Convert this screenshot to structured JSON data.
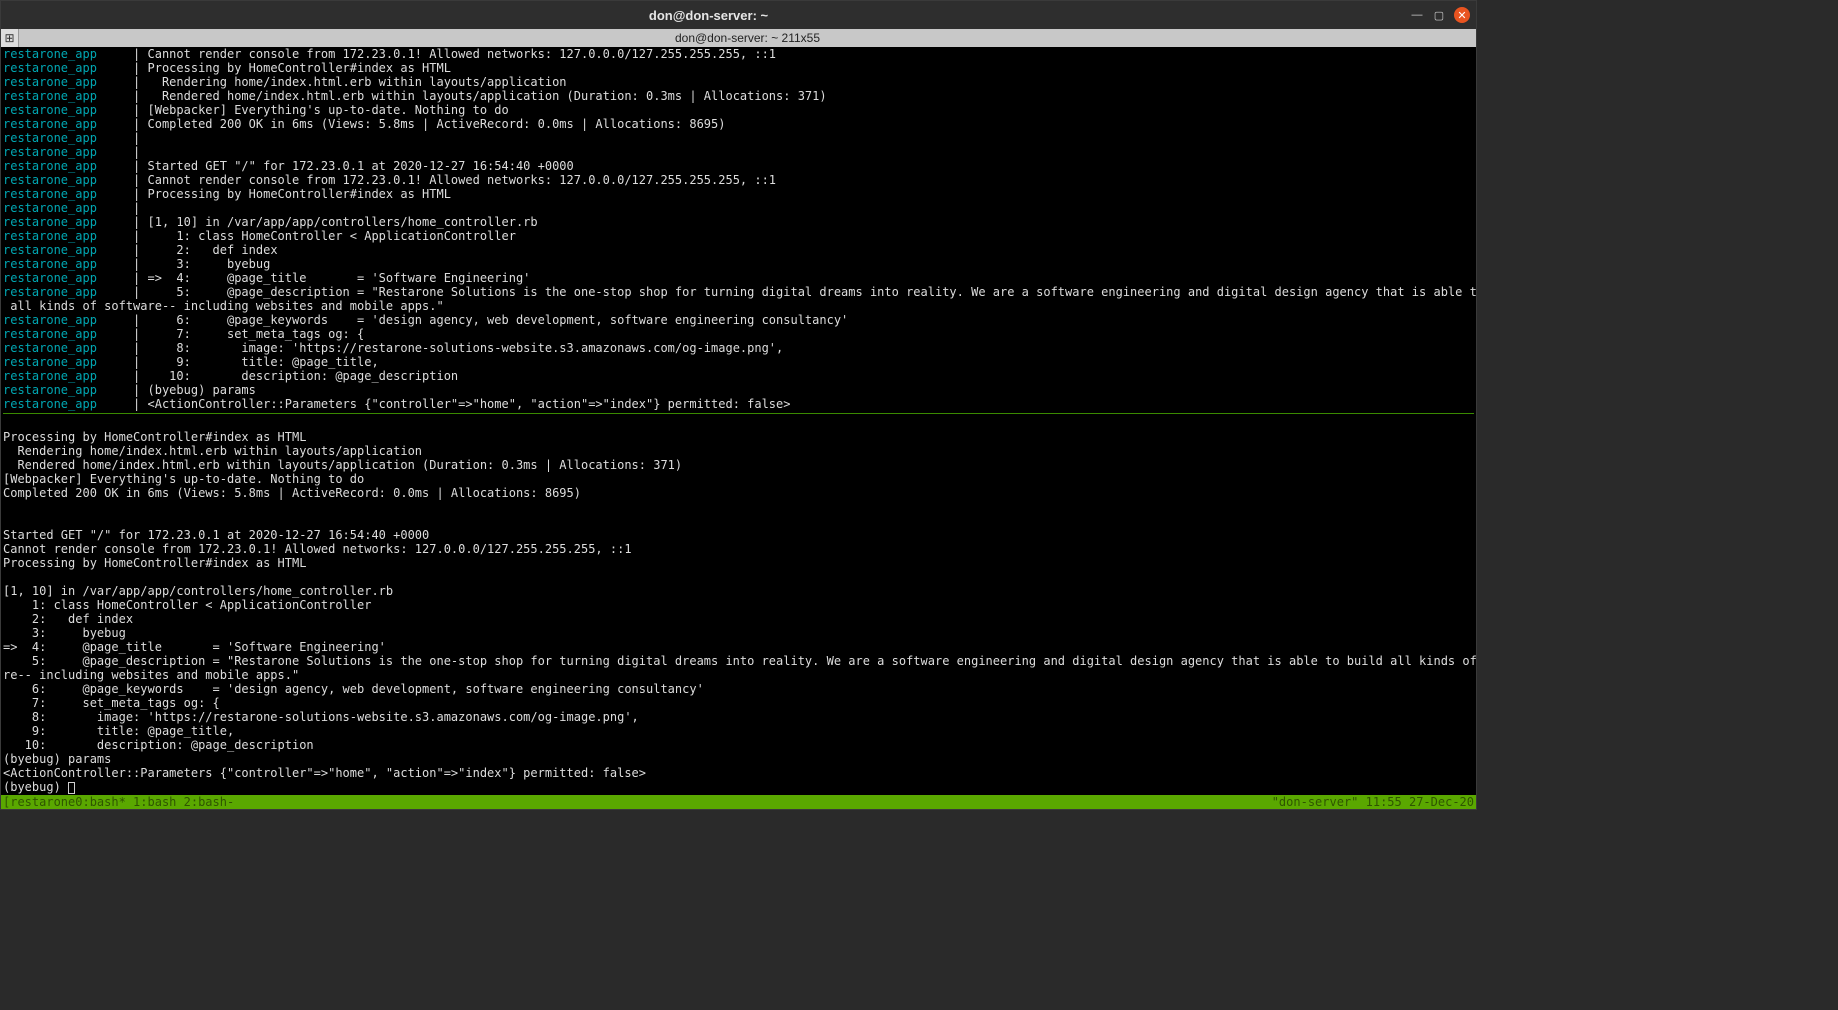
{
  "titlebar": {
    "title": "don@don-server: ~"
  },
  "tab": {
    "label": "don@don-server: ~ 211x55"
  },
  "log_prefix": "restarone_app",
  "pipe": "|",
  "pane1": [
    "Cannot render console from 172.23.0.1! Allowed networks: 127.0.0.0/127.255.255.255, ::1",
    "Processing by HomeController#index as HTML",
    "  Rendering home/index.html.erb within layouts/application",
    "  Rendered home/index.html.erb within layouts/application (Duration: 0.3ms | Allocations: 371)",
    "[Webpacker] Everything's up-to-date. Nothing to do",
    "Completed 200 OK in 6ms (Views: 5.8ms | ActiveRecord: 0.0ms | Allocations: 8695)",
    "",
    "",
    "Started GET \"/\" for 172.23.0.1 at 2020-12-27 16:54:40 +0000",
    "Cannot render console from 172.23.0.1! Allowed networks: 127.0.0.0/127.255.255.255, ::1",
    "Processing by HomeController#index as HTML",
    "",
    "[1, 10] in /var/app/app/controllers/home_controller.rb",
    "    1: class HomeController < ApplicationController",
    "    2:   def index",
    "    3:     byebug",
    "=>  4:     @page_title       = 'Software Engineering'",
    "    5:     @page_description = \"Restarone Solutions is the one-stop shop for turning digital dreams into reality. We are a software engineering and digital design agency that is able to build",
    " all kinds of software-- including websites and mobile apps.\"",
    "    6:     @page_keywords    = 'design agency, web development, software engineering consultancy'",
    "    7:     set_meta_tags og: {",
    "    8:       image: 'https://restarone-solutions-website.s3.amazonaws.com/og-image.png',",
    "    9:       title: @page_title,",
    "   10:       description: @page_description",
    "(byebug) params",
    "<ActionController::Parameters {\"controller\"=>\"home\", \"action\"=>\"index\"} permitted: false>"
  ],
  "pane1_wrap_index": 18,
  "pane2_lines": [
    "",
    "Processing by HomeController#index as HTML",
    "  Rendering home/index.html.erb within layouts/application",
    "  Rendered home/index.html.erb within layouts/application (Duration: 0.3ms | Allocations: 371)",
    "[Webpacker] Everything's up-to-date. Nothing to do",
    "Completed 200 OK in 6ms (Views: 5.8ms | ActiveRecord: 0.0ms | Allocations: 8695)",
    "",
    "",
    "Started GET \"/\" for 172.23.0.1 at 2020-12-27 16:54:40 +0000",
    "Cannot render console from 172.23.0.1! Allowed networks: 127.0.0.0/127.255.255.255, ::1",
    "Processing by HomeController#index as HTML",
    "",
    "[1, 10] in /var/app/app/controllers/home_controller.rb",
    "    1: class HomeController < ApplicationController",
    "    2:   def index",
    "    3:     byebug",
    "=>  4:     @page_title       = 'Software Engineering'",
    "    5:     @page_description = \"Restarone Solutions is the one-stop shop for turning digital dreams into reality. We are a software engineering and digital design agency that is able to build all kinds of softwa",
    "re-- including websites and mobile apps.\"",
    "    6:     @page_keywords    = 'design agency, web development, software engineering consultancy'",
    "    7:     set_meta_tags og: {",
    "    8:       image: 'https://restarone-solutions-website.s3.amazonaws.com/og-image.png',",
    "    9:       title: @page_title,",
    "   10:       description: @page_description",
    "(byebug) params",
    "<ActionController::Parameters {\"controller\"=>\"home\", \"action\"=>\"index\"} permitted: false>",
    "(byebug) "
  ],
  "pane2_cursor_line": 26,
  "statusbar": {
    "left": "[restarone0:bash* 1:bash  2:bash-",
    "right": "\"don-server\" 11:55 27-Dec-20"
  }
}
